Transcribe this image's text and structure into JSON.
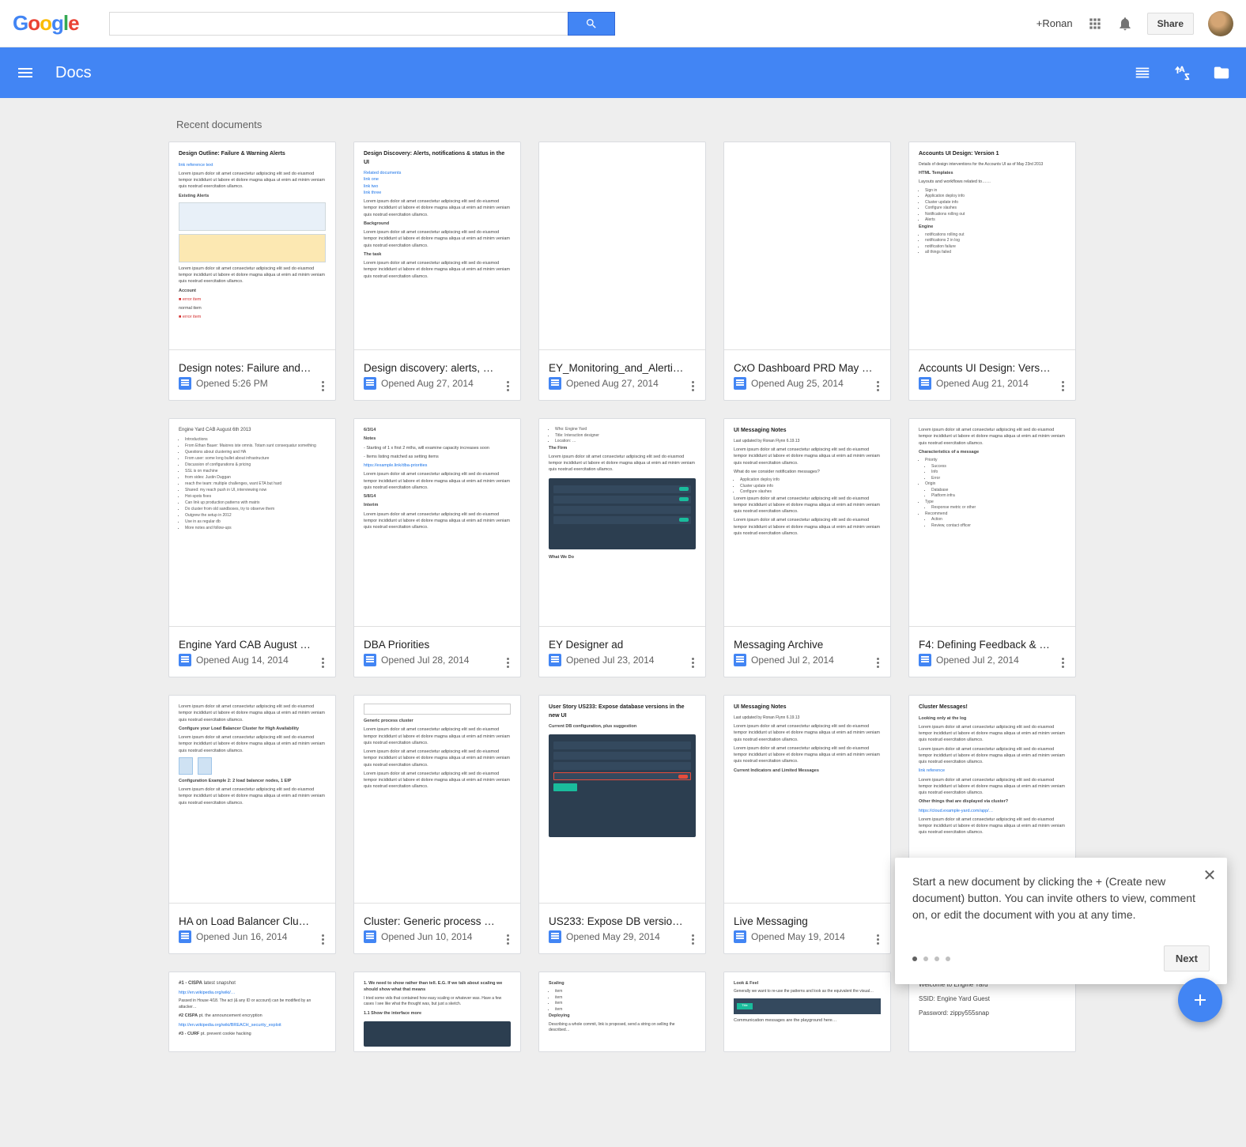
{
  "google_bar": {
    "plus_name": "+Ronan",
    "share_label": "Share"
  },
  "docs_bar": {
    "title": "Docs"
  },
  "section_label": "Recent documents",
  "documents": [
    {
      "title": "Design notes: Failure and…",
      "meta": "Opened  5:26 PM",
      "thumb_title": "Design Outline: Failure & Warning Alerts"
    },
    {
      "title": "Design discovery: alerts, …",
      "meta": "Opened  Aug 27, 2014",
      "thumb_title": "Design Discovery: Alerts, notifications & status in the UI"
    },
    {
      "title": "EY_Monitoring_and_Alerti…",
      "meta": "Opened  Aug 27, 2014",
      "thumb_title": ""
    },
    {
      "title": "CxO Dashboard PRD May …",
      "meta": "Opened  Aug 25, 2014",
      "thumb_title": ""
    },
    {
      "title": "Accounts UI Design: Vers…",
      "meta": "Opened  Aug 21, 2014",
      "thumb_title": "Accounts UI Design: Version 1"
    },
    {
      "title": "Engine Yard CAB August …",
      "meta": "Opened  Aug 14, 2014",
      "thumb_title": ""
    },
    {
      "title": "DBA Priorities",
      "meta": "Opened  Jul 28, 2014",
      "thumb_title": ""
    },
    {
      "title": "EY Designer ad",
      "meta": "Opened  Jul 23, 2014",
      "thumb_title": ""
    },
    {
      "title": "Messaging Archive",
      "meta": "Opened  Jul 2, 2014",
      "thumb_title": "UI Messaging Notes"
    },
    {
      "title": "F4: Defining Feedback & …",
      "meta": "Opened  Jul 2, 2014",
      "thumb_title": ""
    },
    {
      "title": "HA on Load Balancer Clu…",
      "meta": "Opened  Jun 16, 2014",
      "thumb_title": ""
    },
    {
      "title": "Cluster: Generic process …",
      "meta": "Opened  Jun 10, 2014",
      "thumb_title": ""
    },
    {
      "title": "US233: Expose DB versio…",
      "meta": "Opened  May 29, 2014",
      "thumb_title": "User Story US233: Expose database versions in the new UI"
    },
    {
      "title": "Live Messaging",
      "meta": "Opened  May 19, 2014",
      "thumb_title": ""
    },
    {
      "title": "",
      "meta": "",
      "thumb_title": "Cluster Messages!"
    }
  ],
  "partial_row_docs": [
    {
      "thumb_text_a": "Welcome to Engine Yard",
      "thumb_text_b": "SSID: Engine Yard Guest",
      "thumb_text_c": "Password: zippy555snap"
    }
  ],
  "promo": {
    "text": "Start a new document by clicking the + (Create new document) button. You can invite others to view, comment on, or edit the document with you at any time.",
    "next_label": "Next"
  }
}
